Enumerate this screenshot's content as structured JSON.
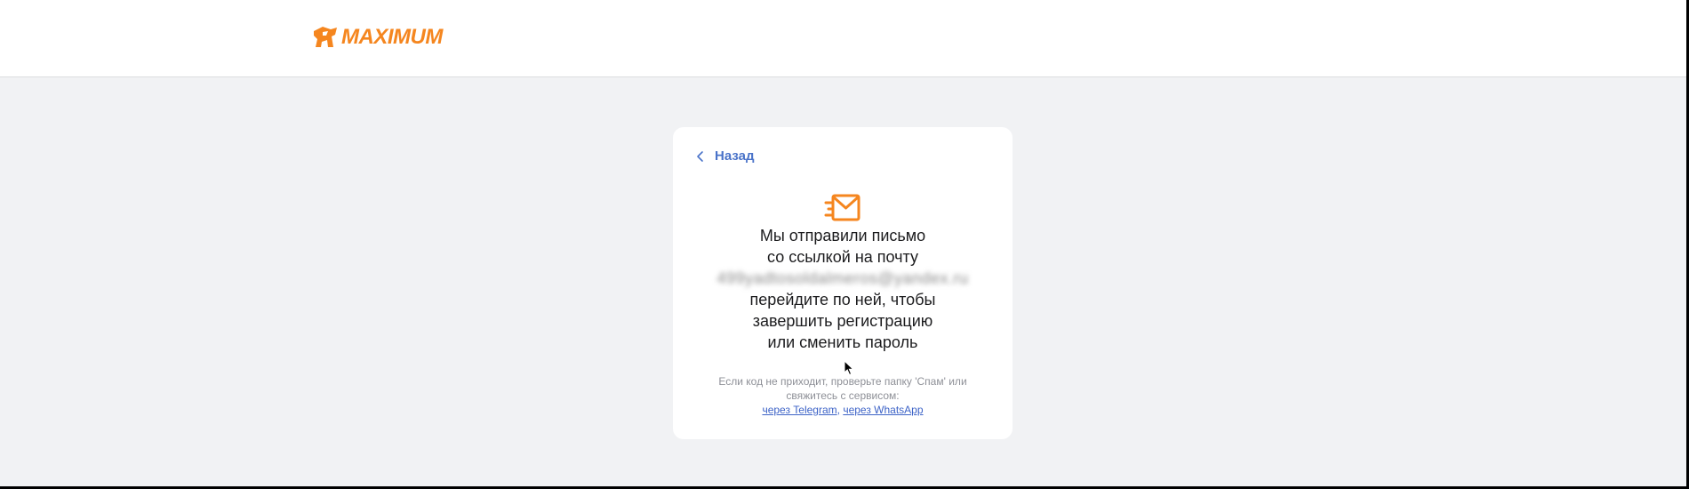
{
  "header": {
    "logo_text": "MAXIMUM",
    "logo_icon": "maximum-logo-icon"
  },
  "colors": {
    "brand": "#f5861f",
    "link": "#4a73c9",
    "page_bg": "#f1f2f4",
    "card_bg": "#ffffff",
    "text": "#1c1c1e",
    "muted": "#8e9097"
  },
  "card": {
    "back_label": "Назад",
    "back_icon": "chevron-left-icon",
    "mail_icon": "envelope-icon",
    "message": {
      "line1": "Мы отправили письмо",
      "line2": "со ссылкой на почту",
      "email": "499yadtosoldalmeros@yandex.ru",
      "line4": "перейдите по ней, чтобы",
      "line5": "завершить регистрацию",
      "line6": "или сменить пароль"
    },
    "hint": {
      "line1": "Если код не приходит, проверьте папку 'Спам' или",
      "line2": "свяжитесь с сервисом:",
      "telegram_link": "через Telegram",
      "separator": ",",
      "whatsapp_link": "через WhatsApp"
    }
  }
}
